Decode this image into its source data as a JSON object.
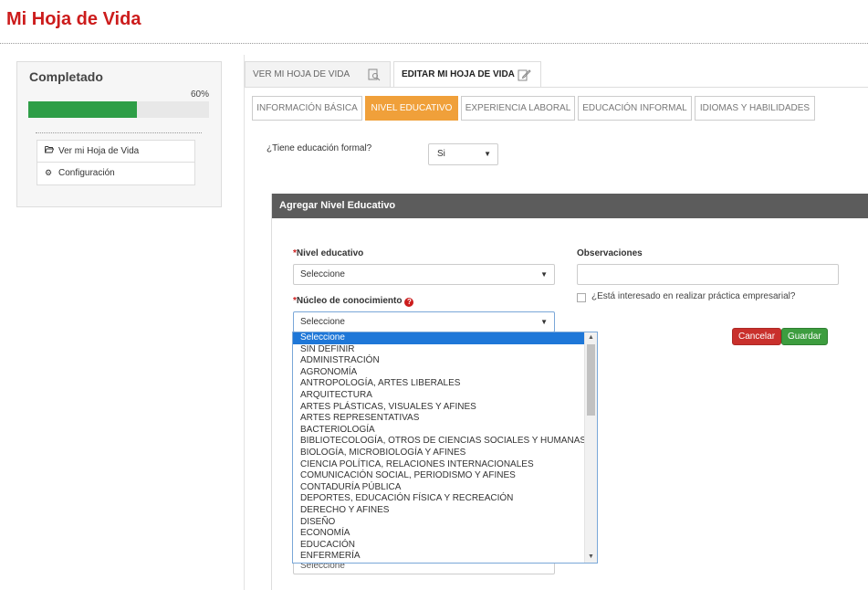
{
  "page": {
    "title": "Mi Hoja de Vida"
  },
  "sidebar": {
    "completed_label": "Completado",
    "progress_text": "60%",
    "progress_value": 0.6,
    "progress_color": "#2e9e47",
    "items": [
      {
        "label": "Ver mi Hoja de Vida",
        "icon": "folder-open-icon"
      },
      {
        "label": "Configuración",
        "icon": "gear-icon"
      }
    ]
  },
  "tabs": {
    "view_label": "VER MI HOJA DE VIDA",
    "edit_label": "EDITAR MI HOJA DE VIDA"
  },
  "subtabs": [
    {
      "label": "INFORMACIÓN BÁSICA",
      "active": false
    },
    {
      "label": "NIVEL EDUCATIVO",
      "active": true
    },
    {
      "label": "EXPERIENCIA LABORAL",
      "active": false
    },
    {
      "label": "EDUCACIÓN INFORMAL",
      "active": false
    },
    {
      "label": "IDIOMAS Y HABILIDADES",
      "active": false
    }
  ],
  "formal": {
    "question": "¿Tiene educación formal?",
    "value": "Si"
  },
  "panel": {
    "title": "Agregar Nivel Educativo",
    "nivel_label": "Nivel educativo",
    "nivel_value": "Seleccione",
    "nucleo_label": "Núcleo de conocimiento",
    "nucleo_value": "Seleccione",
    "obs_label": "Observaciones",
    "obs_value": "",
    "practice_label": "¿Está interesado en realizar práctica empresarial?",
    "required_mark": "*",
    "cancel_label": "Cancelar",
    "save_label": "Guardar",
    "hidden_select_value": "Seleccione"
  },
  "dropdown": {
    "options": [
      "Seleccione",
      "SIN DEFINIR",
      "ADMINISTRACIÓN",
      "AGRONOMÍA",
      "ANTROPOLOGÍA, ARTES LIBERALES",
      "ARQUITECTURA",
      "ARTES PLÁSTICAS, VISUALES Y AFINES",
      "ARTES REPRESENTATIVAS",
      "BACTERIOLOGÍA",
      "BIBLIOTECOLOGÍA, OTROS DE CIENCIAS SOCIALES Y HUMANAS",
      "BIOLOGÍA, MICROBIOLOGÍA Y AFINES",
      "CIENCIA POLÍTICA, RELACIONES INTERNACIONALES",
      "COMUNICACIÓN SOCIAL, PERIODISMO Y AFINES",
      "CONTADURÍA PÚBLICA",
      "DEPORTES, EDUCACIÓN FÍSICA Y RECREACIÓN",
      "DERECHO Y AFINES",
      "DISEÑO",
      "ECONOMÍA",
      "EDUCACIÓN",
      "ENFERMERÍA"
    ],
    "selected_index": 0
  }
}
